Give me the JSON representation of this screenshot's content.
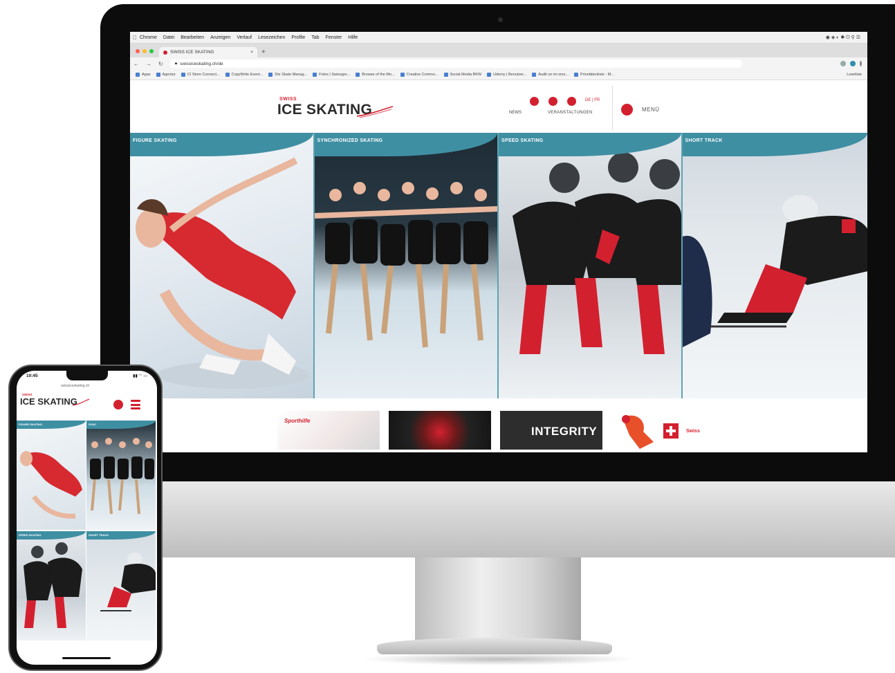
{
  "browser": {
    "menubar_items": [
      "Chrome",
      "Datei",
      "Bearbeiten",
      "Anzeigen",
      "Verlauf",
      "Lesezeichen",
      "Profile",
      "Tab",
      "Fenster",
      "Hilfe"
    ],
    "tab_title": "SWISS ICE SKATING",
    "url": "swissiceskating.ch/de",
    "bookmarks": [
      "Apps",
      "Agentur",
      "CI Store Connect...",
      "CopyWrite Event...",
      "Die Skate Manag...",
      "Fotos | Swissgre...",
      "Browse of the Mo...",
      "Creative Commo...",
      "Social Media BKW",
      "Udemy | Benutzer...",
      "Audit un im sms...",
      "Prioritätenliste - M..."
    ],
    "lesezeichen": "Leseliste"
  },
  "site": {
    "logo_small": "SWISS",
    "logo_big": "ICE SKATING",
    "nav_news": "NEWS",
    "nav_events": "VERANSTALTUNGEN",
    "lang": "DE | FR",
    "menu_label": "MENÜ",
    "colors": {
      "brand_red": "#d3202f",
      "panel_teal": "#3f8fa3"
    }
  },
  "panels": [
    {
      "title": "FIGURE SKATING"
    },
    {
      "title": "SYNCHRONIZED SKATING"
    },
    {
      "title": "SPEED SKATING"
    },
    {
      "title": "SHORT TRACK"
    }
  ],
  "promos": {
    "promo1_text": "Sporthilfe",
    "integrity": "INTEGRITY",
    "promo4_text": "Swiss"
  },
  "phone": {
    "time": "10:45",
    "url": "swissiceskating.ch",
    "logo_small": "SWISS",
    "logo_big": "ICE SKATING",
    "tiles": [
      {
        "title": "FIGURE SKATING"
      },
      {
        "title": "SYNC"
      },
      {
        "title": "SPEED SKATING"
      },
      {
        "title": "SHORT TRACK"
      }
    ]
  }
}
